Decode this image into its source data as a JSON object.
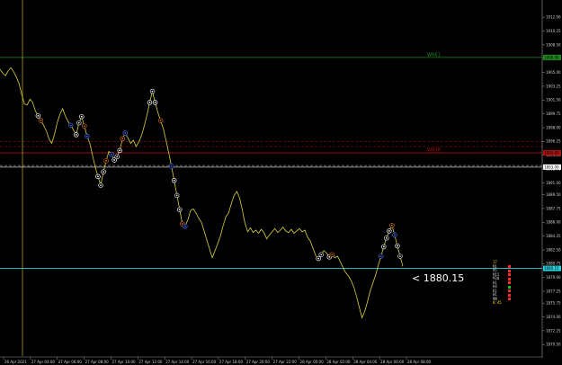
{
  "chart_data": {
    "type": "line",
    "symbol_price_label": "< 1880.15",
    "y_axis_ticks": [
      "1912.00",
      "1908.50",
      "1905.00",
      "1901.50",
      "1898.00",
      "1894.50",
      "1891.00",
      "1887.75",
      "1884.25",
      "1880.75",
      "1877.25",
      "1874.00",
      "1870.50"
    ],
    "y_axis_ticks_raw": [
      {
        "v": "1912.00"
      },
      {
        "v": "1910.25"
      },
      {
        "v": "1908.50"
      },
      {
        "v": "1906.75"
      },
      {
        "v": "1905.00"
      },
      {
        "v": "1903.25"
      },
      {
        "v": "1901.50"
      },
      {
        "v": "1899.75"
      },
      {
        "v": "1898.00"
      },
      {
        "v": "1896.25"
      },
      {
        "v": "1894.50"
      },
      {
        "v": "1892.75"
      },
      {
        "v": "1891.00"
      },
      {
        "v": "1889.50"
      },
      {
        "v": "1887.75"
      },
      {
        "v": "1886.00"
      },
      {
        "v": "1884.25"
      },
      {
        "v": "1882.50"
      },
      {
        "v": "1880.75"
      },
      {
        "v": "1879.00"
      },
      {
        "v": "1877.25"
      },
      {
        "v": "1875.75"
      },
      {
        "v": "1874.00"
      },
      {
        "v": "1872.25"
      },
      {
        "v": "1870.50"
      }
    ],
    "x_axis_ticks": [
      "26 Apr 2021",
      "27 Apr 04:00",
      "27 Apr 06:00",
      "27 Apr 08:00",
      "27 Apr 10:00",
      "27 Apr 12:00",
      "27 Apr 14:00",
      "27 Apr 16:00",
      "27 Apr 18:00",
      "27 Apr 20:00",
      "27 Apr 22:00",
      "28 Apr 00:00",
      "28 Apr 02:00",
      "28 Apr 04:00",
      "28 Apr 06:00",
      "28 Apr 08:00"
    ],
    "ylim": [
      1869.5,
      1913.5
    ],
    "series": [
      {
        "color": "#d8d23a",
        "values": [
          1905.4,
          1904.9,
          1904.6,
          1905.2,
          1905.6,
          1905.1,
          1904.4,
          1903.6,
          1902.2,
          1901.0,
          1900.9,
          1901.6,
          1901.2,
          1900.1,
          1899.5,
          1898.9,
          1898.3,
          1897.6,
          1896.6,
          1896.0,
          1897.1,
          1898.6,
          1899.7,
          1900.4,
          1899.5,
          1898.8,
          1898.3,
          1897.7,
          1897.1,
          1898.6,
          1899.4,
          1898.2,
          1896.9,
          1896.0,
          1894.5,
          1893.0,
          1891.8,
          1890.7,
          1892.4,
          1893.8,
          1895.0,
          1894.6,
          1893.9,
          1894.3,
          1895.1,
          1896.6,
          1897.3,
          1896.7,
          1896.0,
          1896.4,
          1895.6,
          1896.2,
          1897.0,
          1898.2,
          1899.6,
          1901.2,
          1902.6,
          1901.2,
          1899.9,
          1898.9,
          1897.9,
          1896.4,
          1894.8,
          1893.1,
          1891.3,
          1889.4,
          1887.6,
          1885.8,
          1885.5,
          1886.3,
          1887.5,
          1887.7,
          1887.2,
          1886.5,
          1886.0,
          1884.9,
          1883.7,
          1882.6,
          1881.5,
          1882.4,
          1883.3,
          1884.3,
          1885.6,
          1886.7,
          1887.2,
          1888.4,
          1889.4,
          1889.9,
          1889.1,
          1887.6,
          1885.9,
          1884.8,
          1885.3,
          1884.7,
          1885.0,
          1884.6,
          1885.1,
          1884.7,
          1883.9,
          1884.4,
          1884.8,
          1885.2,
          1884.7,
          1885.0,
          1885.4,
          1884.9,
          1884.7,
          1885.1,
          1884.6,
          1884.9,
          1885.2,
          1884.8,
          1885.0,
          1884.1,
          1883.6,
          1882.7,
          1881.8,
          1881.4,
          1881.9,
          1882.4,
          1882.1,
          1881.6,
          1881.9,
          1881.5,
          1881.7,
          1881.0,
          1880.3,
          1879.6,
          1879.2,
          1878.6,
          1877.8,
          1876.6,
          1875.2,
          1873.9,
          1874.7,
          1875.9,
          1877.3,
          1878.3,
          1879.3,
          1880.6,
          1881.7,
          1882.9,
          1884.0,
          1884.9,
          1885.6,
          1884.4,
          1883.0,
          1881.7,
          1880.4
        ]
      }
    ],
    "levels": [
      {
        "label": "WR61",
        "price": 1906.9,
        "color": "#1f8a1f",
        "style": "solid"
      },
      {
        "label": "",
        "price": 1896.25,
        "color": "#b01010",
        "style": "dashed"
      },
      {
        "label": "",
        "price": 1895.6,
        "color": "#b01010",
        "style": "dashed"
      },
      {
        "label": "WR38",
        "price": 1894.8,
        "color": "#b01010",
        "style": "solid"
      },
      {
        "label": "",
        "price": 1893.2,
        "color": "#d0d0d0",
        "style": "dashed"
      },
      {
        "label": "",
        "price": 1893.0,
        "color": "#d0d0d0",
        "style": "solid"
      },
      {
        "label": "",
        "price": 1880.15,
        "color": "#2ad1d8",
        "style": "solid"
      }
    ],
    "level_tags": [
      {
        "price": 1906.9,
        "text": "1906.90",
        "bg": "#1f8a1f"
      },
      {
        "price": 1894.8,
        "text": "1894.80",
        "bg": "#b01010"
      },
      {
        "price": 1893.0,
        "text": "1893.00",
        "bg": "#ffffff"
      },
      {
        "price": 1880.15,
        "text": "1880.15",
        "bg": "#2ad1d8"
      }
    ],
    "grid": false,
    "legend": "none"
  },
  "panel": {
    "rows": [
      {
        "label": "",
        "text": "",
        "color": "#ffd700",
        "value": "17"
      },
      {
        "label": "M1",
        "color": "#ff2b2b"
      },
      {
        "label": "M5",
        "color": "#ff2b2b"
      },
      {
        "label": "M15",
        "color": "#ff2b2b"
      },
      {
        "label": "M30",
        "color": "#ff2b2b"
      },
      {
        "label": "H1",
        "color": "#ff2b2b"
      },
      {
        "label": "H4",
        "color": "#16c416"
      },
      {
        "label": "D1",
        "color": "#ff2b2b"
      },
      {
        "label": "W1",
        "color": "#ff2b2b"
      },
      {
        "label": "MN",
        "color": "#ff2b2b"
      }
    ],
    "countdown": "0:45"
  }
}
